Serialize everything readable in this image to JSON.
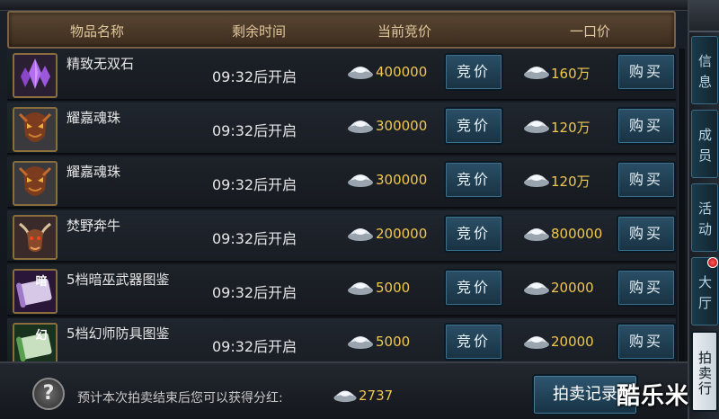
{
  "header": {
    "col_name": "物品名称",
    "col_time": "剩余时间",
    "col_bid": "当前竞价",
    "col_buyout": "一口价"
  },
  "rows": [
    {
      "name": "精致无双石",
      "time": "09:32后开启",
      "bid_price": "400000",
      "bid_label": "竞价",
      "buy_price": "160万",
      "buy_label": "购买",
      "icon": "purple-crystal-icon"
    },
    {
      "name": "耀嘉魂珠",
      "time": "09:32后开启",
      "bid_price": "300000",
      "bid_label": "竞价",
      "buy_price": "120万",
      "buy_label": "购买",
      "icon": "masked-warrior-icon"
    },
    {
      "name": "耀嘉魂珠",
      "time": "09:32后开启",
      "bid_price": "300000",
      "bid_label": "竞价",
      "buy_price": "120万",
      "buy_label": "购买",
      "icon": "masked-warrior-icon"
    },
    {
      "name": "焚野奔牛",
      "time": "09:32后开启",
      "bid_price": "200000",
      "bid_label": "竞价",
      "buy_price": "800000",
      "buy_label": "购买",
      "icon": "bull-beast-icon"
    },
    {
      "name": "5档暗巫武器图鉴",
      "time": "09:32后开启",
      "bid_price": "5000",
      "bid_label": "竞价",
      "buy_price": "20000",
      "buy_label": "购买",
      "icon": "dark-scroll-icon",
      "icon_char": "暗"
    },
    {
      "name": "5档幻师防具图鉴",
      "time": "09:32后开启",
      "bid_price": "5000",
      "bid_label": "竞价",
      "buy_price": "20000",
      "buy_label": "购买",
      "icon": "illusion-scroll-icon",
      "icon_char": "幻"
    }
  ],
  "side_tabs": [
    {
      "label": "信息",
      "active": false
    },
    {
      "label": "成员",
      "active": false
    },
    {
      "label": "活动",
      "active": false
    },
    {
      "label": "大厅",
      "active": false
    },
    {
      "label": "拍卖行",
      "active": true
    }
  ],
  "footer": {
    "help_glyph": "?",
    "text": "预计本次拍卖结束后您可以获得分红:",
    "value": "2737",
    "record_button": "拍卖记录"
  },
  "watermark": "酷乐米",
  "colors": {
    "price": "#f0c850",
    "button": "#234a60",
    "header": "#4d3a28",
    "active_tab": "#e0e6ea"
  }
}
